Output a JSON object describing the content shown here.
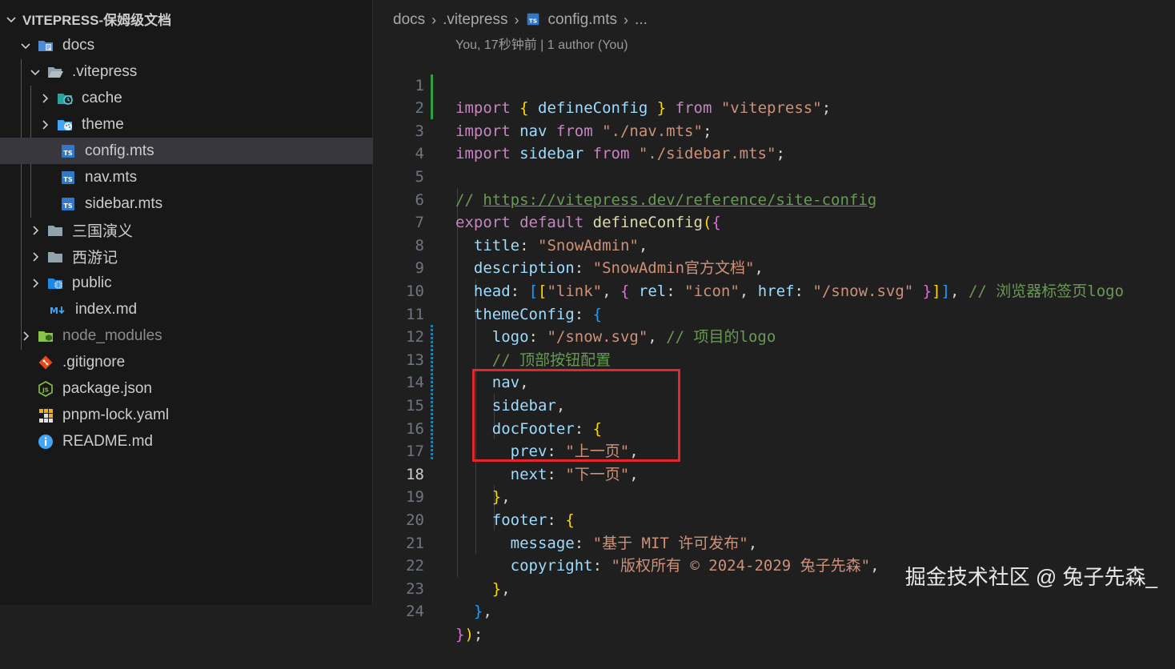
{
  "explorer": {
    "root_label": "VITEPRESS-保姆级文档",
    "items": [
      {
        "label": "docs",
        "chevron": "down",
        "icon": "folder-docs-icon"
      },
      {
        "label": ".vitepress",
        "chevron": "down",
        "icon": "folder-open-icon"
      },
      {
        "label": "cache",
        "chevron": "right",
        "icon": "folder-cache-icon"
      },
      {
        "label": "theme",
        "chevron": "right",
        "icon": "folder-theme-icon"
      },
      {
        "label": "config.mts",
        "icon": "typescript-file-icon",
        "selected": true
      },
      {
        "label": "nav.mts",
        "icon": "typescript-file-icon"
      },
      {
        "label": "sidebar.mts",
        "icon": "typescript-file-icon"
      },
      {
        "label": "三国演义",
        "chevron": "right",
        "icon": "folder-icon"
      },
      {
        "label": "西游记",
        "chevron": "right",
        "icon": "folder-icon"
      },
      {
        "label": "public",
        "chevron": "right",
        "icon": "folder-public-icon"
      },
      {
        "label": "index.md",
        "icon": "markdown-file-icon"
      },
      {
        "label": "node_modules",
        "chevron": "right",
        "icon": "folder-node-icon",
        "dim": true
      },
      {
        "label": ".gitignore",
        "icon": "git-icon"
      },
      {
        "label": "package.json",
        "icon": "nodejs-icon"
      },
      {
        "label": "pnpm-lock.yaml",
        "icon": "pnpm-icon"
      },
      {
        "label": "README.md",
        "icon": "info-icon"
      }
    ]
  },
  "editor": {
    "breadcrumb": {
      "parts": [
        "docs",
        ".vitepress",
        "config.mts",
        "..."
      ],
      "file_icon": "typescript-file-icon"
    },
    "codelens": "You, 17秒钟前 | 1 author (You)",
    "line_numbers": [
      "1",
      "2",
      "3",
      "4",
      "5",
      "6",
      "7",
      "8",
      "9",
      "10",
      "11",
      "12",
      "13",
      "14",
      "15",
      "16",
      "17",
      "18",
      "19",
      "20",
      "21",
      "22",
      "23",
      "24"
    ],
    "code": {
      "l1": {
        "k1": "import",
        "b1": "{",
        "id": "defineConfig",
        "b2": "}",
        "k2": "from",
        "s": "\"vitepress\"",
        "p": ";"
      },
      "l2": {
        "k1": "import",
        "id": "nav",
        "k2": "from",
        "s": "\"./nav.mts\"",
        "p": ";"
      },
      "l3": {
        "k1": "import",
        "id": "sidebar",
        "k2": "from",
        "s": "\"./sidebar.mts\"",
        "p": ";"
      },
      "l5": {
        "c": "//",
        "url": "https://vitepress.dev/reference/site-config"
      },
      "l6": {
        "k1": "export",
        "k2": "default",
        "fn": "defineConfig",
        "b1": "(",
        "b2": "{"
      },
      "l7": {
        "key": "title",
        "colon": ":",
        "s": "\"SnowAdmin\"",
        "p": ","
      },
      "l8": {
        "key": "description",
        "colon": ":",
        "s": "\"SnowAdmin官方文档\"",
        "p": ","
      },
      "l9": {
        "key": "head",
        "colon": ":",
        "b1": "[",
        "b2": "[",
        "s1": "\"link\"",
        "p1": ",",
        "b3": "{",
        "k2": "rel",
        "c2": ":",
        "s2": "\"icon\"",
        "p2": ",",
        "k3": "href",
        "c3": ":",
        "s3": "\"/snow.svg\"",
        "b3c": "}",
        "b2c": "]",
        "b1c": "]",
        "p3": ",",
        "cm": "// 浏览器标签页logo"
      },
      "l10": {
        "key": "themeConfig",
        "colon": ":",
        "b": "{"
      },
      "l11": {
        "key": "logo",
        "colon": ":",
        "s": "\"/snow.svg\"",
        "p": ",",
        "cm": "// 项目的logo"
      },
      "l12": {
        "cm": "// 顶部按钮配置"
      },
      "l13": {
        "id": "nav",
        "p": ","
      },
      "l14": {
        "id": "sidebar",
        "p": ","
      },
      "l15": {
        "key": "docFooter",
        "colon": ":",
        "b": "{"
      },
      "l16": {
        "key": "prev",
        "colon": ":",
        "s": "\"上一页\"",
        "p": ","
      },
      "l17": {
        "key": "next",
        "colon": ":",
        "s": "\"下一页\"",
        "p": ","
      },
      "l18": {
        "b": "}",
        "p": ","
      },
      "l19": {
        "key": "footer",
        "colon": ":",
        "b": "{"
      },
      "l20": {
        "key": "message",
        "colon": ":",
        "s": "\"基于 MIT 许可发布\"",
        "p": ","
      },
      "l21": {
        "key": "copyright",
        "colon": ":",
        "s": "\"版权所有 © 2024-2029 兔子先森\"",
        "p": ","
      },
      "l22": {
        "b": "}",
        "p": ","
      },
      "l23": {
        "b": "}",
        "p": ","
      },
      "l24": {
        "b1": "}",
        "b2": ")",
        "p": ";"
      }
    }
  },
  "watermark": "掘金技术社区 @ 兔子先森_",
  "colors": {
    "keyword": "#c586c0",
    "string": "#ce9178",
    "variable": "#9cdcfe",
    "function": "#dcdcaa",
    "comment": "#6a9955",
    "highlight": "#e5252a"
  }
}
